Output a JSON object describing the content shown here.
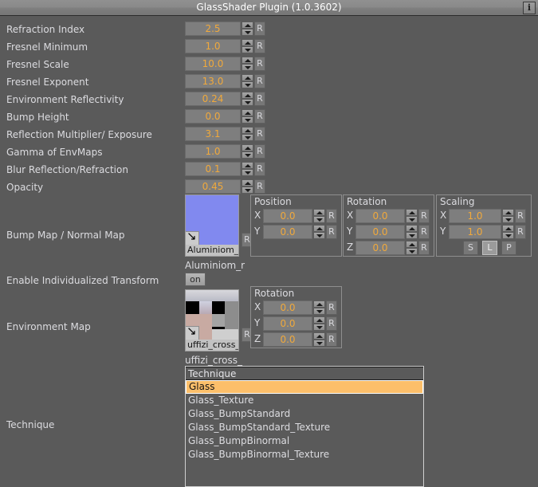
{
  "window": {
    "title": "GlassShader Plugin (1.0.3602)",
    "info_icon": "info-icon",
    "info_label": "i"
  },
  "colors": {
    "background": "#5a5a5a",
    "value_text": "#f0a93c",
    "label_text": "#dcdce0",
    "selection": "#fcbf6a",
    "normal_map_blue": "#8189ef"
  },
  "sliders": [
    {
      "label": "Refraction Index",
      "value": "2.5",
      "reset": "R"
    },
    {
      "label": "Fresnel Minimum",
      "value": "1.0",
      "reset": "R"
    },
    {
      "label": "Fresnel Scale",
      "value": "10.0",
      "reset": "R"
    },
    {
      "label": "Fresnel Exponent",
      "value": "13.0",
      "reset": "R"
    },
    {
      "label": "Environment Reflectivity",
      "value": "0.24",
      "reset": "R"
    },
    {
      "label": "Bump Height",
      "value": "0.0",
      "reset": "R"
    },
    {
      "label": "Reflection Multiplier/ Exposure",
      "value": "3.1",
      "reset": "R"
    },
    {
      "label": "Gamma of EnvMaps",
      "value": "1.0",
      "reset": "R"
    },
    {
      "label": "Blur Reflection/Refraction",
      "value": "0.1",
      "reset": "R"
    },
    {
      "label": "Opacity",
      "value": "0.45",
      "reset": "R"
    }
  ],
  "bump_map": {
    "label": "Bump Map / Normal Map",
    "texture_caption": "Aluminiom_r",
    "texture_name": "Aluminiom_r",
    "reset": "R",
    "position": {
      "title": "Position",
      "axes": [
        {
          "axis": "X",
          "value": "0.0",
          "reset": "R"
        },
        {
          "axis": "Y",
          "value": "0.0",
          "reset": "R"
        }
      ]
    },
    "rotation": {
      "title": "Rotation",
      "axes": [
        {
          "axis": "X",
          "value": "0.0",
          "reset": "R"
        },
        {
          "axis": "Y",
          "value": "0.0",
          "reset": "R"
        },
        {
          "axis": "Z",
          "value": "0.0",
          "reset": "R"
        }
      ]
    },
    "scaling": {
      "title": "Scaling",
      "axes": [
        {
          "axis": "X",
          "value": "1.0",
          "reset": "R"
        },
        {
          "axis": "Y",
          "value": "1.0",
          "reset": "R"
        }
      ],
      "modes": [
        {
          "label": "S",
          "active": false
        },
        {
          "label": "L",
          "active": true
        },
        {
          "label": "P",
          "active": false
        }
      ]
    }
  },
  "individualized_transform": {
    "label": "Enable Individualized Transform",
    "state": "on"
  },
  "environment_map": {
    "label": "Environment Map",
    "texture_caption": "uffizi_cross_",
    "texture_name": "uffizi_cross_",
    "reset": "R",
    "rotation": {
      "title": "Rotation",
      "axes": [
        {
          "axis": "X",
          "value": "0.0",
          "reset": "R"
        },
        {
          "axis": "Y",
          "value": "0.0",
          "reset": "R"
        },
        {
          "axis": "Z",
          "value": "0.0",
          "reset": "R"
        }
      ]
    }
  },
  "technique": {
    "label": "Technique",
    "header": "Technique",
    "selected": "Glass",
    "options": [
      "Glass",
      "Glass_Texture",
      "Glass_BumpStandard",
      "Glass_BumpStandard_Texture",
      "Glass_BumpBinormal",
      "Glass_BumpBinormal_Texture"
    ]
  }
}
